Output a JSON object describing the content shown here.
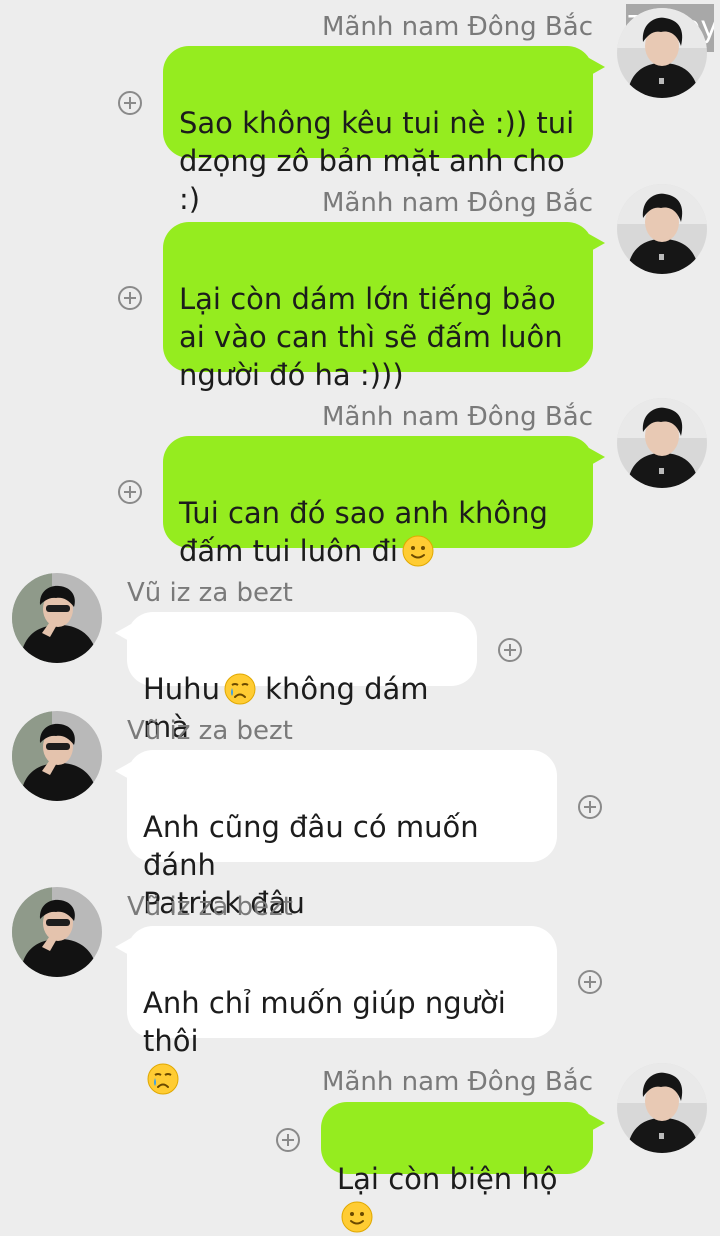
{
  "watermark": "74 joy",
  "senders": {
    "outgoing": "Mãnh nam Đông Bắc",
    "incoming": "Vũ iz za bezt"
  },
  "messages": [
    {
      "side": "out",
      "text": "Sao không kêu tui nè :)) tui\ndzọng zô bản mặt anh cho :)",
      "emoji": ""
    },
    {
      "side": "out",
      "text": "Lại còn dám lớn tiếng bảo\nai vào can thì sẽ đấm luôn\nngười đó ha :)))",
      "emoji": ""
    },
    {
      "side": "out",
      "text": "Tui can đó sao anh không\nđấm tui luôn đi",
      "emoji": "slightly-smiling-face-emoji"
    },
    {
      "side": "in",
      "text": "Huhu",
      "emoji": "crying-face-emoji",
      "text_after": " không dám mà"
    },
    {
      "side": "in",
      "text": "Anh cũng đâu có muốn đánh\nPatrick đâu",
      "emoji": ""
    },
    {
      "side": "in",
      "text": "Anh chỉ muốn giúp người thôi\n",
      "emoji": "crying-face-emoji"
    },
    {
      "side": "out",
      "text": "Lại còn biện hộ",
      "emoji": "slightly-smiling-face-emoji"
    }
  ],
  "icons": {
    "add": "plus-circle-icon",
    "avatar_out": "avatar-photo",
    "avatar_in": "avatar-photo"
  },
  "colors": {
    "background": "#ededed",
    "outgoing_bubble": "#95ec1f",
    "incoming_bubble": "#ffffff"
  }
}
